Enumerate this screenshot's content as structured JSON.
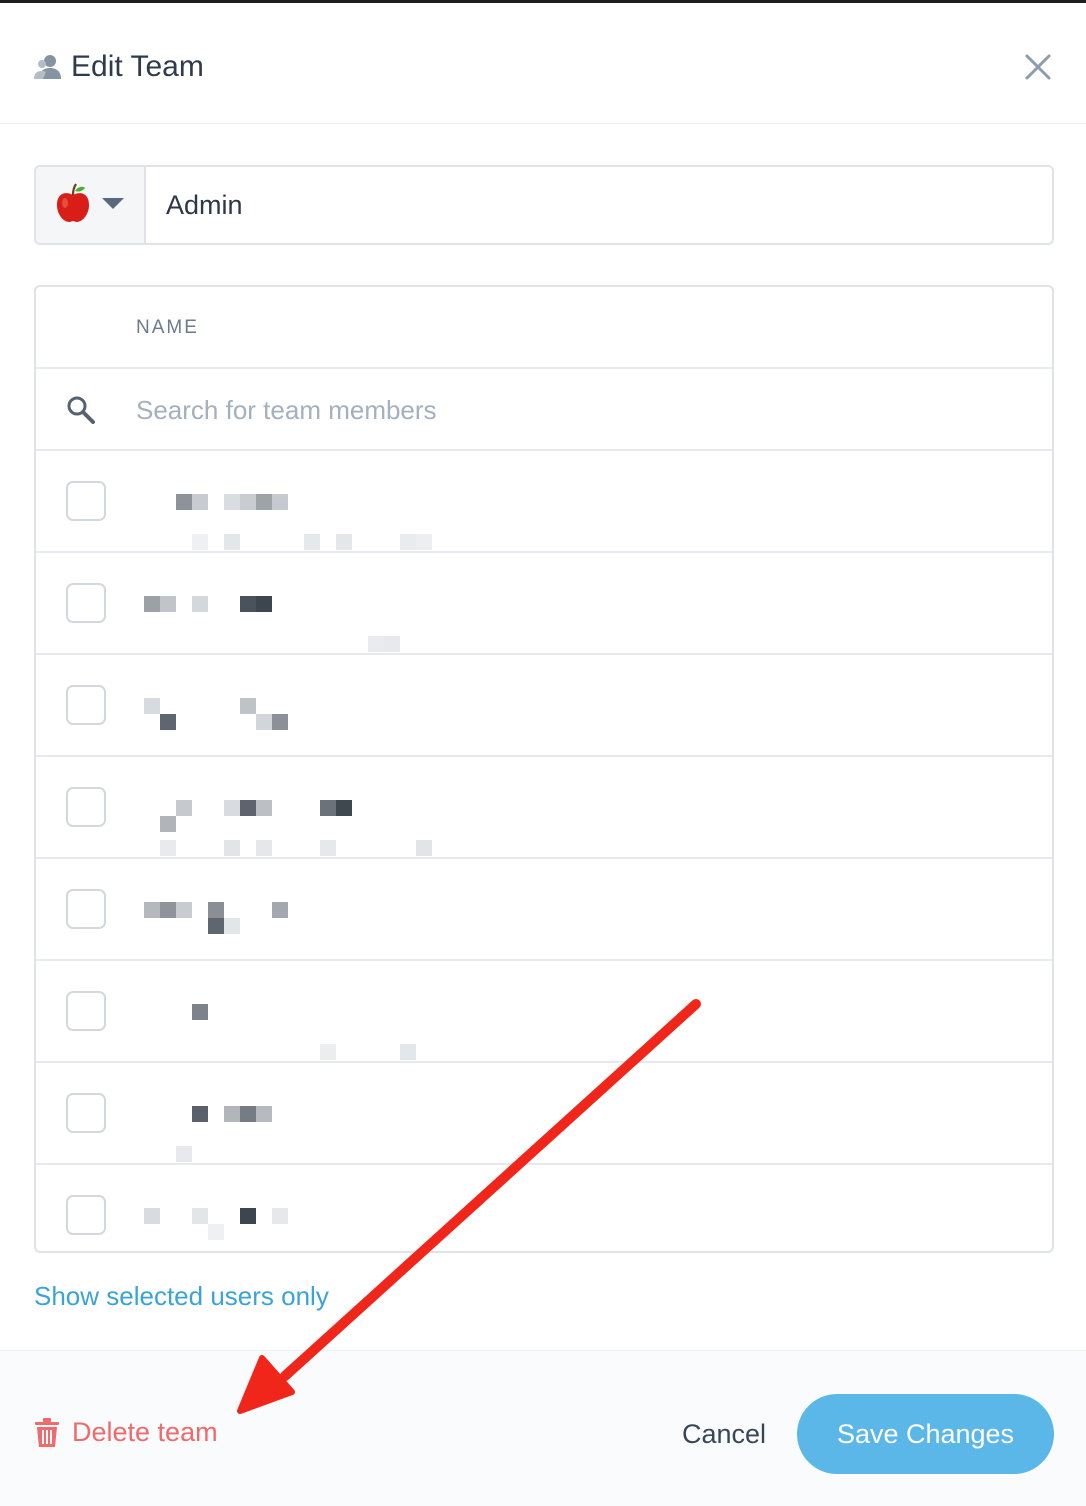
{
  "header": {
    "title": "Edit Team",
    "icon": "team-user-icon",
    "close_icon": "close-icon"
  },
  "team": {
    "emoji": "apple-icon",
    "name": "Admin"
  },
  "members_table": {
    "column_header": "NAME",
    "search_placeholder": "Search for team members",
    "rows": [
      {
        "name": "",
        "selected": false
      },
      {
        "name": "",
        "selected": false
      },
      {
        "name": "",
        "selected": false
      },
      {
        "name": "",
        "selected": false
      },
      {
        "name": "",
        "selected": false
      },
      {
        "name": "",
        "selected": false
      },
      {
        "name": "",
        "selected": false
      },
      {
        "name": "",
        "selected": false
      }
    ]
  },
  "show_selected_label": "Show selected users only",
  "footer": {
    "delete_label": "Delete team",
    "cancel_label": "Cancel",
    "save_label": "Save Changes"
  },
  "colors": {
    "accent": "#5bb7e8",
    "link": "#3aa3d7",
    "danger": "#ef6a6a",
    "annotation_arrow": "#f0261b"
  }
}
